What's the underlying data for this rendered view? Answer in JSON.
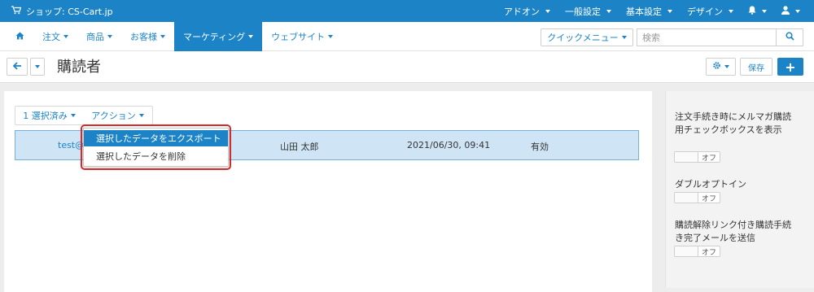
{
  "topbar": {
    "shop_label": "ショップ: CS-Cart.jp",
    "nav": [
      "アドオン",
      "一般設定",
      "基本設定",
      "デザイン"
    ]
  },
  "mainnav": {
    "tabs": [
      {
        "label": "注文"
      },
      {
        "label": "商品"
      },
      {
        "label": "お客様"
      },
      {
        "label": "マーケティング"
      },
      {
        "label": "ウェブサイト"
      }
    ],
    "quick_menu": "クイックメニュー",
    "search_placeholder": "検索"
  },
  "page": {
    "title": "購読者",
    "save_label": "保存"
  },
  "toolbar": {
    "selected_label": "1 選択済み",
    "actions_label": "アクション"
  },
  "actions_menu": {
    "options": [
      "選択したデータをエクスポート",
      "選択したデータを削除"
    ]
  },
  "table": {
    "row": {
      "email": "test@c",
      "name": "山田 太郎",
      "date": "2021/06/30, 09:41",
      "status": "有効"
    }
  },
  "sidebar": {
    "settings": [
      {
        "label": "注文手続き時にメルマガ購読用チェックボックスを表示",
        "toggle": "オフ"
      },
      {
        "label": "ダブルオプトイン",
        "toggle": "オフ"
      },
      {
        "label": "購読解除リンク付き購読手続き完了メールを送信",
        "toggle": "オフ"
      }
    ]
  },
  "colors": {
    "brand": "#1c84c6",
    "row_selected": "#cfe4f5",
    "highlight": "#d32a2a"
  }
}
